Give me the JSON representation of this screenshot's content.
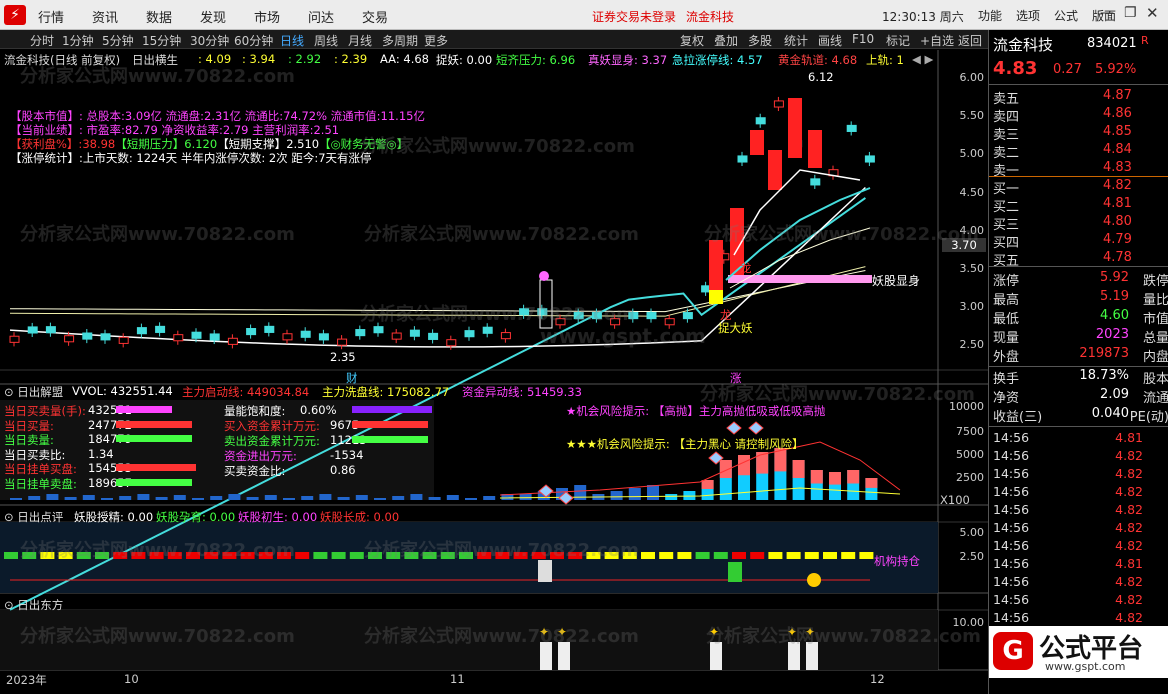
{
  "topbar": {
    "menus": [
      "行情",
      "资讯",
      "数据",
      "发现",
      "市场",
      "问达",
      "交易"
    ],
    "notice": "证券交易未登录",
    "stock": "流金科技",
    "time": "12:30:13 周六",
    "right_menus": [
      "功能",
      "选项",
      "公式",
      "版面"
    ]
  },
  "periods": [
    "分时",
    "1分钟",
    "5分钟",
    "15分钟",
    "30分钟",
    "60分钟",
    "日线",
    "周线",
    "月线",
    "多周期",
    "更多"
  ],
  "active_period": "日线",
  "tools": [
    "复权",
    "叠加",
    "多股",
    "统计",
    "画线",
    "F10",
    "标记",
    "+自选",
    "返回"
  ],
  "indicator_row": {
    "name": "流金科技(日线 前复权)",
    "ind": "日出横生",
    "v1": ": 4.09",
    "v2": ": 3.94",
    "v3": ": 2.92",
    "v4": ": 2.39",
    "aa": "AA: 4.68",
    "zy": "捉妖: 0.00",
    "dq": "短齐压力: 6.96",
    "zys": "真妖显身: 3.37",
    "jl": "急拉涨停线: 4.57",
    "hj": "黄金轨道: 4.68",
    "sg": "上轨: 1"
  },
  "info": {
    "l1": "【股本市值】: 总股本:3.09亿 流通盘:2.31亿 流通比:74.72% 流通市值:11.15亿",
    "l2": "【当前业绩】: 市盈率:82.79 净资收益率:2.79 主营利润率:2.51",
    "l3a": "【获利盘%】:",
    "l3b": "38.98",
    "l3c": "【短期压力】",
    "l3d": "6.120",
    "l3e": "【短期支撑】",
    "l3f": "2.510",
    "l3g": "【◎财务无警◎】",
    "l4": "【涨停统计】:上市天数: 1224天 半年内涨停次数: 2次 距今:7天有涨停"
  },
  "main_axis": [
    "6.00",
    "5.50",
    "5.00",
    "4.50",
    "4.00",
    "3.50",
    "3.00",
    "2.50"
  ],
  "price_marks": {
    "high": "6.12",
    "low": "2.35",
    "cur": "3.70"
  },
  "annot": {
    "yaoxian": "妖股显身",
    "long1": "龙",
    "long2": "龙",
    "zhuo": "捉大妖",
    "cai": "财",
    "zhang": "涨"
  },
  "watermark": "分析家公式网www.70822.com",
  "site": "www.gspt.com",
  "p2": {
    "title": "日出解盟",
    "vol": "VVOL: 432551.44",
    "zl": "主力启动线: 449034.84",
    "xp": "主力洗盘线: 175082.77",
    "zj": "资金异动线: 51459.33",
    "axis": [
      "10000",
      "7500",
      "5000",
      "2500"
    ],
    "x100": "X100",
    "left": [
      [
        "当日买卖量(手):",
        "432551"
      ],
      [
        "当日买量:",
        "247772"
      ],
      [
        "当日卖量:",
        "184779"
      ],
      [
        "当日买卖比:",
        "1.34"
      ],
      [
        "当日挂单买盘:",
        "154553"
      ],
      [
        "当日挂单卖盘:",
        "189657"
      ]
    ],
    "mid": [
      [
        "量能饱和度:",
        "0.60%"
      ],
      [
        "买入资金累计万元:",
        "9675"
      ],
      [
        "卖出资金累计万元:",
        "11213"
      ],
      [
        "资金进出万元:",
        "-1534"
      ],
      [
        "买卖资金比:",
        "0.86"
      ]
    ],
    "tip1": "★机会风险提示: 【高抛】主力高抛低吸或低吸高抛",
    "tip2": "★★★机会风险提示: 【主力黑心 请控制风险】"
  },
  "p3": {
    "title": "日出点评",
    "a": "妖股授精: 0.00",
    "b": "妖股孕育: 0.00",
    "c": "妖股初生: 0.00",
    "d": "妖股长成: 0.00",
    "axis": [
      "5.00",
      "2.50"
    ],
    "hold": "机构持仓"
  },
  "p4": {
    "title": "日出东方",
    "axis": [
      "10.00"
    ]
  },
  "dates": [
    "2023年",
    "10",
    "11",
    "12"
  ],
  "quote": {
    "name": "流金科技",
    "code": "834021",
    "r": "R",
    "price": "4.83",
    "chg": "0.27",
    "pct": "5.92%",
    "asks": [
      [
        "卖五",
        "4.87"
      ],
      [
        "卖四",
        "4.86"
      ],
      [
        "卖三",
        "4.85"
      ],
      [
        "卖二",
        "4.84"
      ],
      [
        "卖一",
        "4.83"
      ]
    ],
    "bids": [
      [
        "买一",
        "4.82"
      ],
      [
        "买二",
        "4.81"
      ],
      [
        "买三",
        "4.80"
      ],
      [
        "买四",
        "4.79"
      ],
      [
        "买五",
        "4.78"
      ]
    ],
    "stats": [
      [
        "涨停",
        "5.92",
        "跌停"
      ],
      [
        "最高",
        "5.19",
        "量比"
      ],
      [
        "最低",
        "4.60",
        "市值"
      ],
      [
        "现量",
        "2023",
        "总量"
      ],
      [
        "外盘",
        "219873",
        "内盘"
      ]
    ],
    "stats2": [
      [
        "换手",
        "18.73%",
        "股本"
      ],
      [
        "净资",
        "2.09",
        "流通"
      ],
      [
        "收益(三)",
        "0.040",
        "PE(动)"
      ]
    ],
    "ticks": [
      [
        "14:56",
        "4.81"
      ],
      [
        "14:56",
        "4.82"
      ],
      [
        "14:56",
        "4.82"
      ],
      [
        "14:56",
        "4.82"
      ],
      [
        "14:56",
        "4.82"
      ],
      [
        "14:56",
        "4.82"
      ],
      [
        "14:56",
        "4.82"
      ],
      [
        "14:56",
        "4.81"
      ],
      [
        "14:56",
        "4.82"
      ],
      [
        "14:56",
        "4.82"
      ],
      [
        "14:56",
        "4.82"
      ],
      [
        "14:56",
        "4.82"
      ]
    ]
  },
  "brand": "公式平台",
  "brand_url": "www.gspt.com"
}
